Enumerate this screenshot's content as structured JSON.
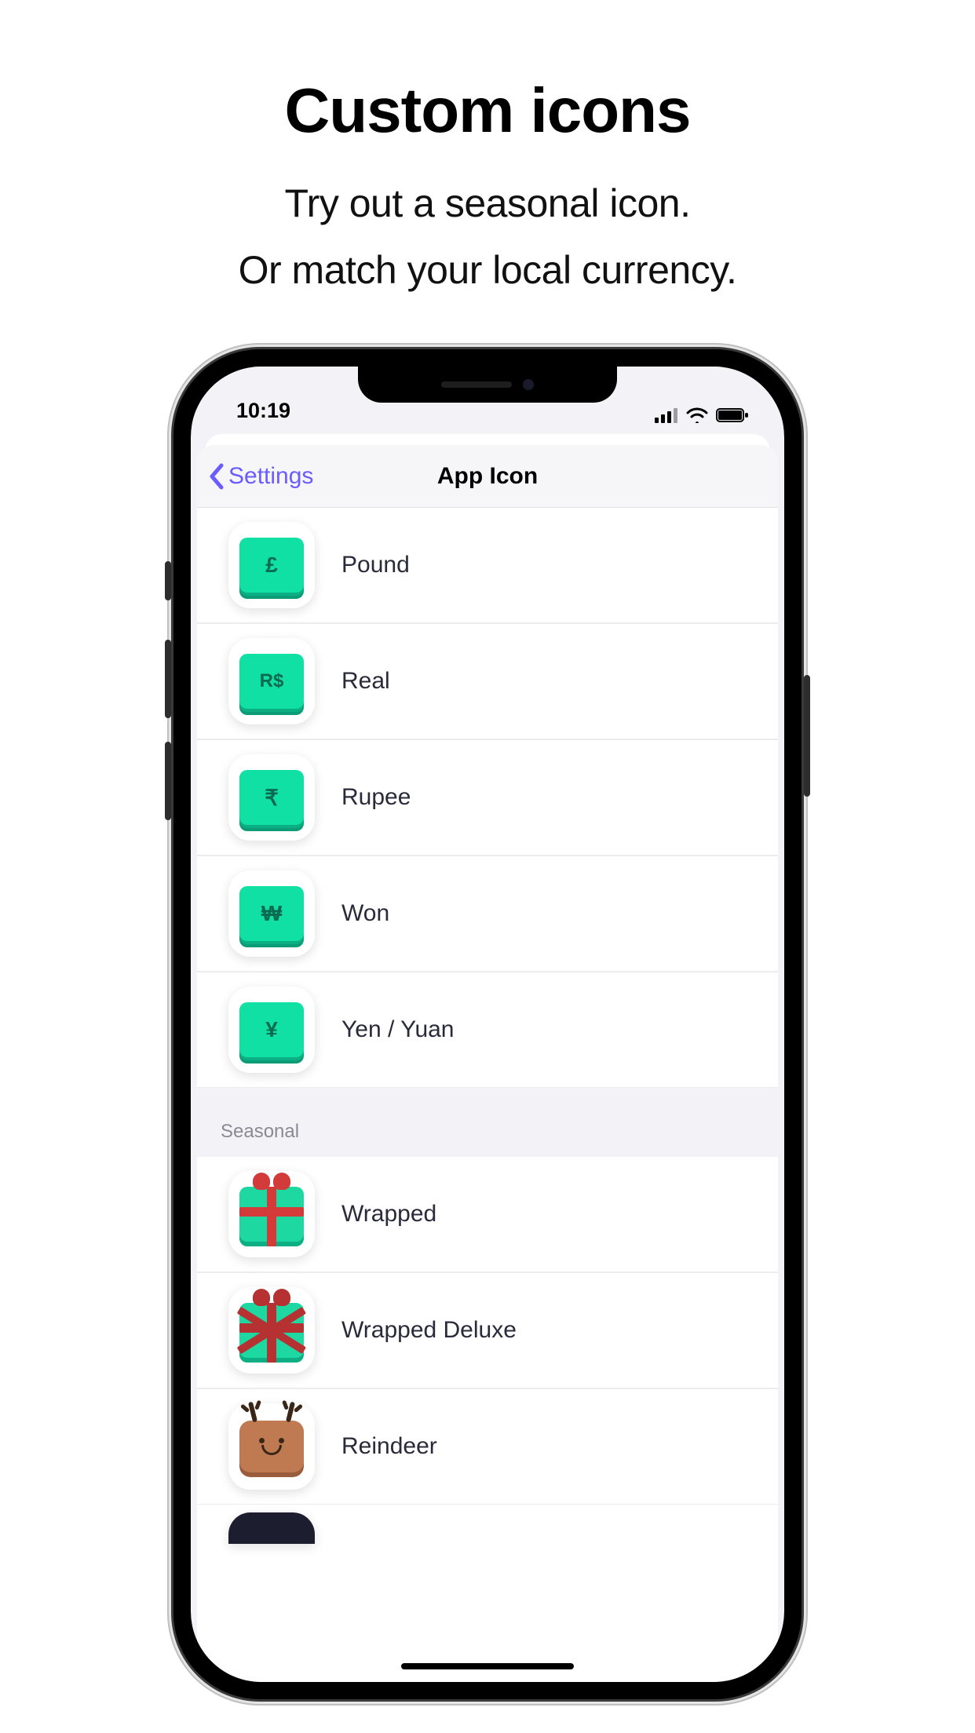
{
  "promo": {
    "title": "Custom icons",
    "line1": "Try out a seasonal icon.",
    "line2": "Or match your local currency."
  },
  "status": {
    "time": "10:19"
  },
  "nav": {
    "back": "Settings",
    "title": "App Icon"
  },
  "currency_items": [
    {
      "label": "Pound",
      "symbol": "£",
      "icon": "pound-icon"
    },
    {
      "label": "Real",
      "symbol": "R$",
      "icon": "real-icon"
    },
    {
      "label": "Rupee",
      "symbol": "₹",
      "icon": "rupee-icon"
    },
    {
      "label": "Won",
      "symbol": "₩",
      "icon": "won-icon"
    },
    {
      "label": "Yen / Yuan",
      "symbol": "¥",
      "icon": "yen-icon"
    }
  ],
  "seasonal_header": "Seasonal",
  "seasonal_items": [
    {
      "label": "Wrapped",
      "icon": "wrapped-icon"
    },
    {
      "label": "Wrapped Deluxe",
      "icon": "wrapped-deluxe-icon"
    },
    {
      "label": "Reindeer",
      "icon": "reindeer-icon"
    }
  ],
  "colors": {
    "accent": "#6b5cff",
    "key": "#10e0a3"
  }
}
